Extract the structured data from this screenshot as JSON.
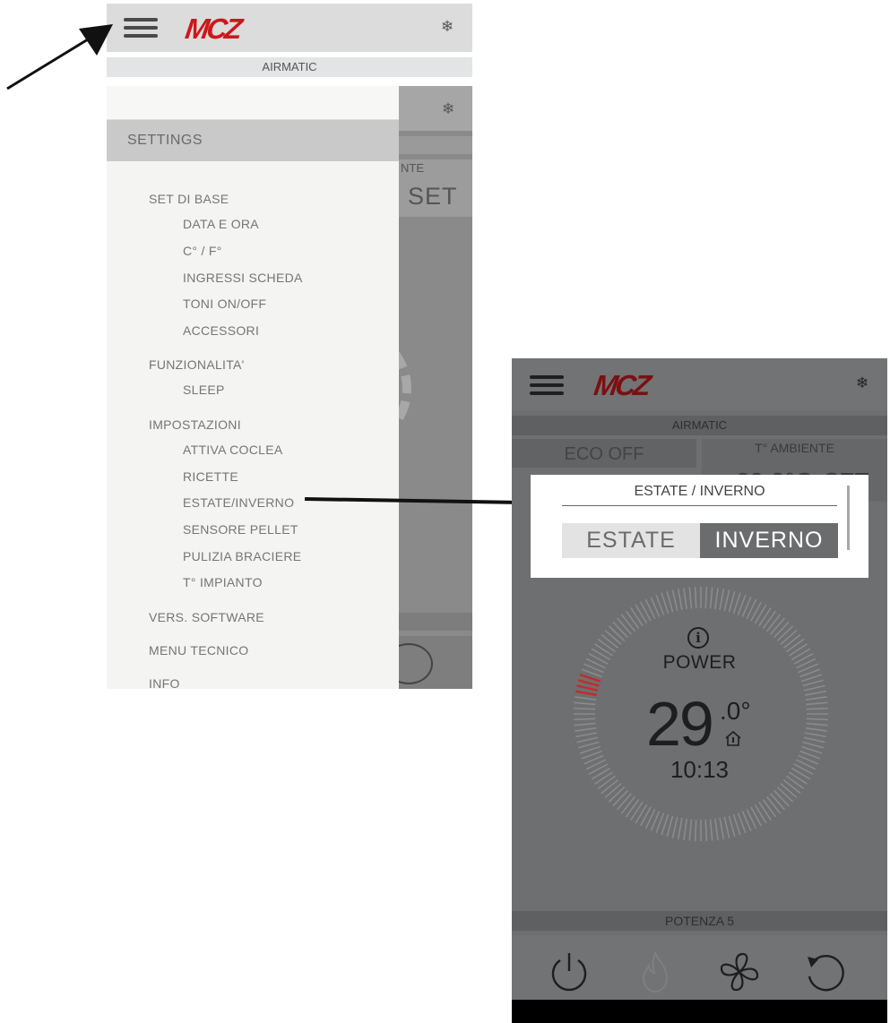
{
  "left_screen": {
    "brand": "MCZ",
    "mode_label": "AIRMATIC",
    "background_labels": {
      "ambient_partial": "NTE",
      "set": "SET"
    },
    "drawer": {
      "title": "SETTINGS",
      "items": [
        {
          "label": "SET DI BASE",
          "level": 1
        },
        {
          "label": "DATA E ORA",
          "level": 2
        },
        {
          "label": "C° / F°",
          "level": 2
        },
        {
          "label": "INGRESSI SCHEDA",
          "level": 2
        },
        {
          "label": "TONI ON/OFF",
          "level": 2
        },
        {
          "label": "ACCESSORI",
          "level": 2
        },
        {
          "label": "FUNZIONALITA'",
          "level": 1
        },
        {
          "label": "SLEEP",
          "level": 2
        },
        {
          "label": "IMPOSTAZIONI",
          "level": 1
        },
        {
          "label": "ATTIVA COCLEA",
          "level": 2
        },
        {
          "label": "RICETTE",
          "level": 2
        },
        {
          "label": "ESTATE/INVERNO",
          "level": 2
        },
        {
          "label": "SENSORE PELLET",
          "level": 2
        },
        {
          "label": "PULIZIA BRACIERE",
          "level": 2
        },
        {
          "label": "T° IMPIANTO",
          "level": 2
        },
        {
          "label": "VERS. SOFTWARE",
          "level": 1
        },
        {
          "label": "MENU TECNICO",
          "level": 1
        },
        {
          "label": "INFO",
          "level": 1
        }
      ]
    }
  },
  "right_screen": {
    "brand": "MCZ",
    "mode_label": "AIRMATIC",
    "eco_label": "ECO OFF",
    "ambient": {
      "label": "T° AMBIENTE",
      "value": "29.0°C",
      "set": "SET"
    },
    "popup": {
      "title": "ESTATE / INVERNO",
      "options": [
        "ESTATE",
        "INVERNO"
      ],
      "selected": "INVERNO"
    },
    "dial": {
      "status": "POWER",
      "temperature_int": "29",
      "temperature_dec": ".0°",
      "time": "10:13"
    },
    "power_level_label": "POTENZA 5"
  },
  "icons": {
    "menu": "hamburger-menu-icon",
    "snowflake": "❄",
    "info": "i",
    "power": "power-icon",
    "flame": "flame-icon",
    "fan": "fan-icon",
    "refresh": "refresh-icon",
    "house": "house-thermometer-icon"
  },
  "colors": {
    "brand_red": "#d0161b",
    "selected_segment": "#6a6c6e",
    "unselected_segment": "#e3e3e3",
    "dial_indicator": "#c62a2a"
  }
}
